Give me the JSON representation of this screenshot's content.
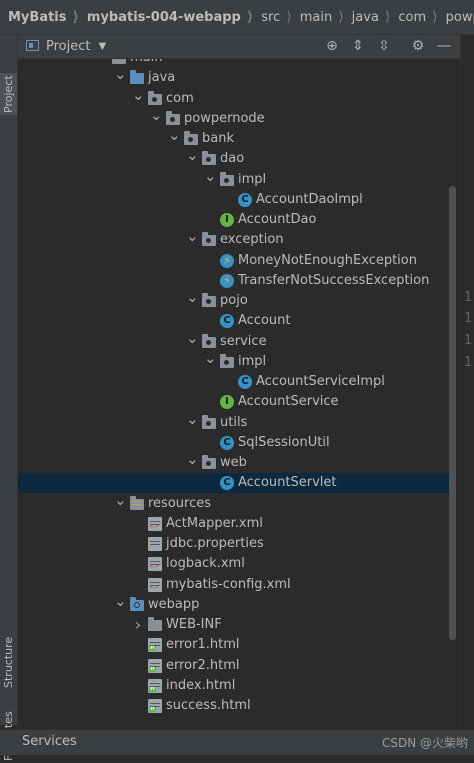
{
  "breadcrumb": [
    "MyBatis",
    "mybatis-004-webapp",
    "src",
    "main",
    "java",
    "com",
    "powpernode"
  ],
  "left_tabs": {
    "project": "Project",
    "structure": "Structure",
    "favorites": "Favorites"
  },
  "panel": {
    "title": "Project"
  },
  "tree": [
    {
      "label": "main",
      "depth": 0,
      "icon": "folder-icon",
      "arrow": "down"
    },
    {
      "label": "java",
      "depth": 1,
      "icon": "source-folder-icon",
      "arrow": "down"
    },
    {
      "label": "com",
      "depth": 2,
      "icon": "package-icon",
      "arrow": "down"
    },
    {
      "label": "powpernode",
      "depth": 3,
      "icon": "package-icon",
      "arrow": "down"
    },
    {
      "label": "bank",
      "depth": 4,
      "icon": "package-icon",
      "arrow": "down"
    },
    {
      "label": "dao",
      "depth": 5,
      "icon": "package-icon",
      "arrow": "down"
    },
    {
      "label": "impl",
      "depth": 6,
      "icon": "package-icon",
      "arrow": "down"
    },
    {
      "label": "AccountDaoImpl",
      "depth": 7,
      "icon": "class-icon",
      "arrow": ""
    },
    {
      "label": "AccountDao",
      "depth": 6,
      "icon": "interface-icon",
      "arrow": ""
    },
    {
      "label": "exception",
      "depth": 5,
      "icon": "package-icon",
      "arrow": "down"
    },
    {
      "label": "MoneyNotEnoughException",
      "depth": 6,
      "icon": "exception-icon",
      "arrow": ""
    },
    {
      "label": "TransferNotSuccessException",
      "depth": 6,
      "icon": "exception-icon",
      "arrow": ""
    },
    {
      "label": "pojo",
      "depth": 5,
      "icon": "package-icon",
      "arrow": "down"
    },
    {
      "label": "Account",
      "depth": 6,
      "icon": "class-icon",
      "arrow": ""
    },
    {
      "label": "service",
      "depth": 5,
      "icon": "package-icon",
      "arrow": "down"
    },
    {
      "label": "impl",
      "depth": 6,
      "icon": "package-icon",
      "arrow": "down"
    },
    {
      "label": "AccountServiceImpl",
      "depth": 7,
      "icon": "class-icon",
      "arrow": ""
    },
    {
      "label": "AccountService",
      "depth": 6,
      "icon": "interface-icon",
      "arrow": ""
    },
    {
      "label": "utils",
      "depth": 5,
      "icon": "package-icon",
      "arrow": "down"
    },
    {
      "label": "SqlSessionUtil",
      "depth": 6,
      "icon": "class-icon",
      "arrow": ""
    },
    {
      "label": "web",
      "depth": 5,
      "icon": "package-icon",
      "arrow": "down"
    },
    {
      "label": "AccountServlet",
      "depth": 6,
      "icon": "class-icon",
      "arrow": "",
      "selected": true
    },
    {
      "label": "resources",
      "depth": 1,
      "icon": "resources-folder-icon",
      "arrow": "down"
    },
    {
      "label": "ActMapper.xml",
      "depth": 2,
      "icon": "xml-file-icon",
      "arrow": ""
    },
    {
      "label": "jdbc.properties",
      "depth": 2,
      "icon": "properties-file-icon",
      "arrow": ""
    },
    {
      "label": "logback.xml",
      "depth": 2,
      "icon": "xml-file-icon",
      "arrow": ""
    },
    {
      "label": "mybatis-config.xml",
      "depth": 2,
      "icon": "xml-file-icon",
      "arrow": ""
    },
    {
      "label": "webapp",
      "depth": 1,
      "icon": "web-folder-icon",
      "arrow": "down"
    },
    {
      "label": "WEB-INF",
      "depth": 2,
      "icon": "folder-icon",
      "arrow": "right"
    },
    {
      "label": "error1.html",
      "depth": 2,
      "icon": "html-file-icon",
      "arrow": ""
    },
    {
      "label": "error2.html",
      "depth": 2,
      "icon": "html-file-icon",
      "arrow": ""
    },
    {
      "label": "index.html",
      "depth": 2,
      "icon": "html-file-icon",
      "arrow": ""
    },
    {
      "label": "success.html",
      "depth": 2,
      "icon": "html-file-icon",
      "arrow": ""
    }
  ],
  "editor_gutter": [
    "1",
    "1",
    "1",
    "1"
  ],
  "bottom": {
    "services": "Services",
    "watermark": "CSDN @火柴哟"
  },
  "colors": {
    "selection": "#0d293e",
    "class": "#3592c4",
    "interface": "#62b543",
    "background": "#2b2b2b"
  }
}
